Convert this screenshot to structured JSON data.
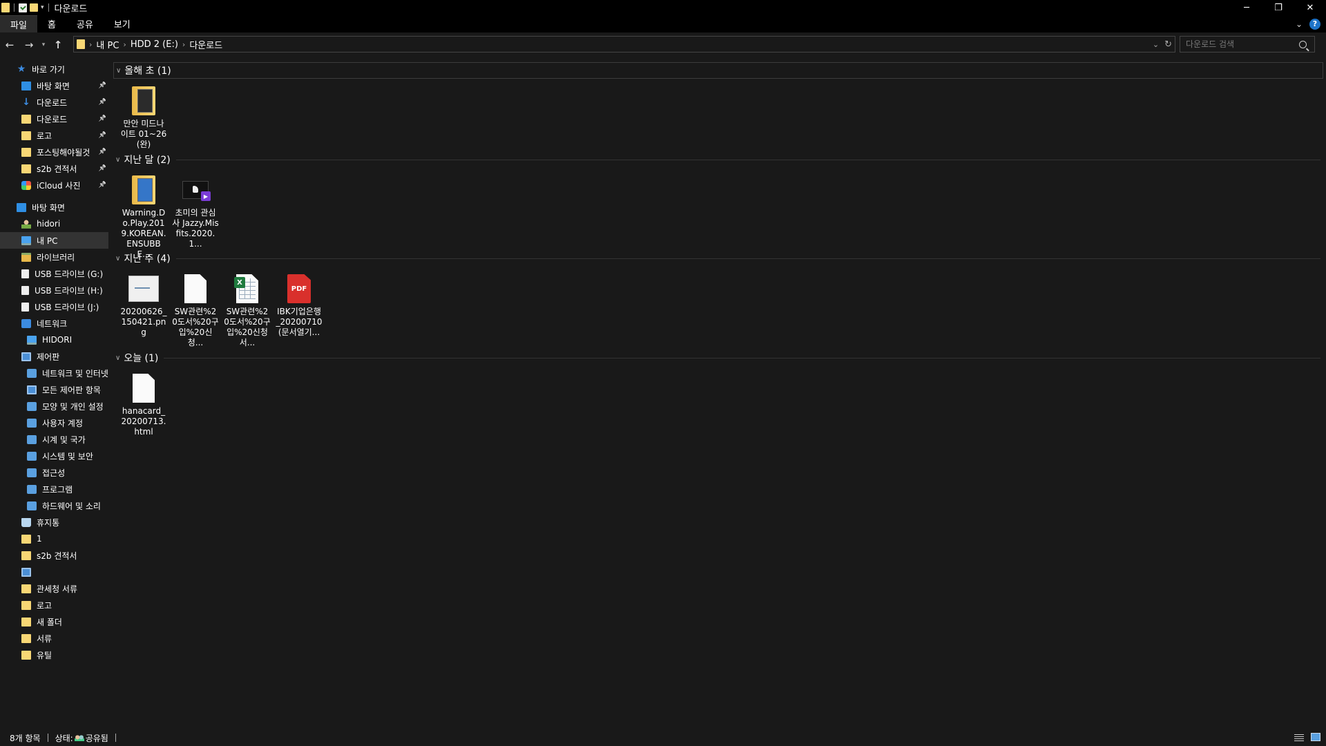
{
  "window": {
    "title": "다운로드",
    "controls": {
      "minimize": "─",
      "restore": "❐",
      "close": "✕"
    }
  },
  "ribbon": {
    "tabs": [
      {
        "label": "파일",
        "active": true
      },
      {
        "label": "홈"
      },
      {
        "label": "공유"
      },
      {
        "label": "보기"
      }
    ],
    "help_label": "?"
  },
  "address": {
    "breadcrumbs": [
      "내 PC",
      "HDD 2 (E:)",
      "다운로드"
    ],
    "search_placeholder": "다운로드 검색"
  },
  "sidebar": {
    "items": [
      {
        "label": "바로 가기",
        "icon": "star-icon",
        "indent": 1,
        "pinned": false
      },
      {
        "label": "바탕 화면",
        "icon": "desktop-icon",
        "indent": 2,
        "pinned": true
      },
      {
        "label": "다운로드",
        "icon": "download-arrow-icon",
        "indent": 2,
        "pinned": true
      },
      {
        "label": "다운로드",
        "icon": "folder-icon",
        "indent": 2,
        "pinned": true
      },
      {
        "label": "로고",
        "icon": "folder-icon",
        "indent": 2,
        "pinned": true
      },
      {
        "label": "포스팅해야될것",
        "icon": "folder-icon",
        "indent": 2,
        "pinned": true
      },
      {
        "label": "s2b 견적서",
        "icon": "folder-icon",
        "indent": 2,
        "pinned": true
      },
      {
        "label": "iCloud 사진",
        "icon": "icloud-photos-icon",
        "indent": 2,
        "pinned": true
      },
      {
        "label": "",
        "icon": "",
        "indent": 0,
        "spacer": true
      },
      {
        "label": "바탕 화면",
        "icon": "desktop-icon",
        "indent": 1
      },
      {
        "label": "hidori",
        "icon": "user-icon",
        "indent": 2
      },
      {
        "label": "내 PC",
        "icon": "pc-icon",
        "indent": 2,
        "selected": true
      },
      {
        "label": "라이브러리",
        "icon": "library-icon",
        "indent": 2
      },
      {
        "label": "USB 드라이브 (G:)",
        "icon": "usb-drive-icon",
        "indent": 2
      },
      {
        "label": "USB 드라이브 (H:)",
        "icon": "usb-drive-icon",
        "indent": 2
      },
      {
        "label": "USB 드라이브 (J:)",
        "icon": "usb-drive-icon",
        "indent": 2
      },
      {
        "label": "네트워크",
        "icon": "network-icon",
        "indent": 2
      },
      {
        "label": "HIDORI",
        "icon": "computer-icon",
        "indent": 3
      },
      {
        "label": "제어판",
        "icon": "control-panel-icon",
        "indent": 2
      },
      {
        "label": "네트워크 및 인터넷",
        "icon": "network-internet-icon",
        "indent": 3
      },
      {
        "label": "모든 제어판 항목",
        "icon": "control-panel-icon",
        "indent": 3
      },
      {
        "label": "모양 및 개인 설정",
        "icon": "appearance-icon",
        "indent": 3
      },
      {
        "label": "사용자 계정",
        "icon": "user-accounts-icon",
        "indent": 3
      },
      {
        "label": "시계 및 국가",
        "icon": "clock-region-icon",
        "indent": 3
      },
      {
        "label": "시스템 및 보안",
        "icon": "security-icon",
        "indent": 3
      },
      {
        "label": "접근성",
        "icon": "accessibility-icon",
        "indent": 3
      },
      {
        "label": "프로그램",
        "icon": "programs-icon",
        "indent": 3
      },
      {
        "label": "하드웨어 및 소리",
        "icon": "hardware-sound-icon",
        "indent": 3
      },
      {
        "label": "휴지통",
        "icon": "recycle-bin-icon",
        "indent": 2
      },
      {
        "label": "1",
        "icon": "folder-icon",
        "indent": 2
      },
      {
        "label": "s2b 견적서",
        "icon": "folder-icon",
        "indent": 2
      },
      {
        "label": "",
        "icon": "control-panel-icon",
        "indent": 2
      },
      {
        "label": "관세청 서류",
        "icon": "folder-icon",
        "indent": 2
      },
      {
        "label": "로고",
        "icon": "folder-icon",
        "indent": 2
      },
      {
        "label": "새 폴더",
        "icon": "folder-icon",
        "indent": 2
      },
      {
        "label": "서류",
        "icon": "folder-icon",
        "indent": 2
      },
      {
        "label": "유틸",
        "icon": "folder-icon",
        "indent": 2
      }
    ]
  },
  "groups": [
    {
      "label": "올해 초 (1)",
      "items": [
        {
          "name": "만안 미드나이트 01~26(완)",
          "type": "folder-dark"
        }
      ]
    },
    {
      "label": "지난 달 (2)",
      "items": [
        {
          "name": "Warning.Do.Play.2019.KOREAN.ENSUBBE...",
          "type": "folder-blue"
        },
        {
          "name": "초미의 관심사 Jazzy.Misfits.2020.1...",
          "type": "video"
        }
      ]
    },
    {
      "label": "지난 주 (4)",
      "items": [
        {
          "name": "20200626_150421.png",
          "type": "png"
        },
        {
          "name": "SW관련%20도서%20구입%20신청...",
          "type": "doc"
        },
        {
          "name": "SW관련%20도서%20구입%20신청서...",
          "type": "xls"
        },
        {
          "name": "IBK기업은행_20200710(문서열기...",
          "type": "pdf"
        }
      ]
    },
    {
      "label": "오늘 (1)",
      "items": [
        {
          "name": "hanacard_20200713.html",
          "type": "doc"
        }
      ]
    }
  ],
  "icon_text": {
    "pdf": "PDF",
    "xls": "X"
  },
  "status": {
    "count": "8개 항목",
    "state_label": "상태:",
    "state_value": "공유됨"
  },
  "colors": {
    "folder": "#f8d775",
    "accent": "#1e74c9",
    "background": "#191919",
    "pdf": "#d9302c"
  }
}
